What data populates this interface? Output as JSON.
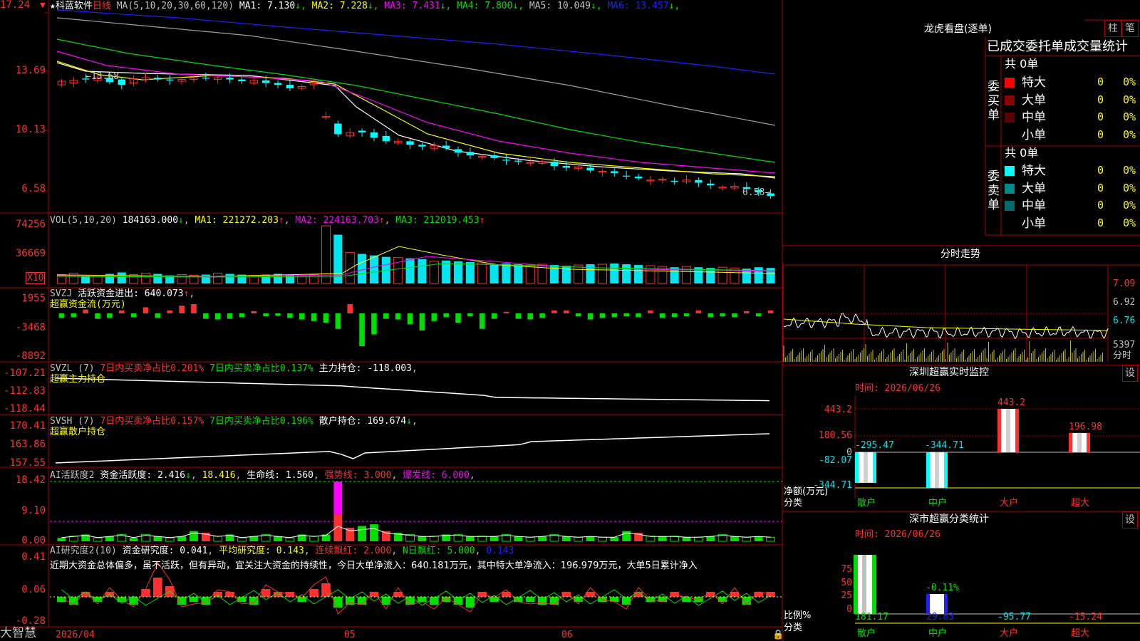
{
  "colors": {
    "up": "#ff3030",
    "down": "#00ffff",
    "vol_down": "#00e5ee",
    "green": "#00e000",
    "yellow": "#ffff00",
    "magenta": "#ff00ff",
    "white": "#ffffff",
    "blue": "#2020ff",
    "grid": "#b00000"
  },
  "main": {
    "stock_name": "科蓝软件",
    "period": "日线",
    "ma_params": "MA(5,10,20,30,60,120)",
    "ma_values": [
      {
        "label": "MA1: 7.130",
        "arrow": "↓",
        "color": "#ffffff"
      },
      {
        "label": "MA2: 7.228",
        "arrow": "↓",
        "color": "#ffff00"
      },
      {
        "label": "MA3: 7.431",
        "arrow": "↓",
        "color": "#ff00ff"
      },
      {
        "label": "MA4: 7.800",
        "arrow": "↓",
        "color": "#00e000"
      },
      {
        "label": "MA5: 10.049",
        "arrow": "↓",
        "color": "#c0c0c0"
      },
      {
        "label": "MA6: 13.457",
        "arrow": "↓",
        "color": "#2020ff"
      }
    ],
    "yticks": [
      "17.24",
      "13.69",
      "10.13",
      "6.58"
    ],
    "high_label": "13.68",
    "low_label": "6.58"
  },
  "vol": {
    "title": "VOL(5,10,20)",
    "value": "184163.000",
    "ma1": "MA1: 221272.203",
    "ma2": "MA2: 224163.703",
    "ma3": "MA3: 212019.453",
    "yticks": [
      "74256",
      "36669"
    ],
    "unit": "X10"
  },
  "svzj": {
    "title": "SVZJ",
    "label": "活跃资金进出: 640.073",
    "subtitle": "超赢资金流(万元)",
    "yticks": [
      "1955",
      "-3468",
      "-8892"
    ]
  },
  "svzl": {
    "title": "SVZL (7)",
    "a": "7日内买卖净占比0.201%",
    "b": "7日内买卖净占比0.137%",
    "c": "主力持仓: -118.003",
    "subtitle": "超赢主力持仓",
    "yticks": [
      "-107.21",
      "-112.83",
      "-118.44"
    ]
  },
  "svsh": {
    "title": "SVSH (7)",
    "a": "7日内买卖净占比0.157%",
    "b": "7日内买卖净占比0.196%",
    "c": "散户持仓: 169.674",
    "subtitle": "超赢散户持仓",
    "yticks": [
      "170.41",
      "163.86",
      "157.55"
    ]
  },
  "ai2": {
    "title": "AI活跃度2",
    "a": "资金活跃度: 2.416",
    "b": "18.416",
    "c": "生命线: 1.560",
    "d": "强势线: 3.000",
    "e": "爆发线: 6.000",
    "yticks": [
      "18.42",
      "9.10",
      "0.00"
    ]
  },
  "ai_research": {
    "title": "AI研究度2(10)",
    "a": "资金研究度: 0.041",
    "b": "平均研究度: 0.143",
    "c": "连续飘红: 2.000",
    "d": "N日飘红: 5.000",
    "e": "0.143",
    "comment": "近期大资金总体偏多，虽不活跃，但有异动，宜关注大资金的持续性，今日大单净流入：640.181万元，其中特大单净流入：196.979万元，大单5日累计净入",
    "yticks": [
      "0.41",
      "0.06",
      "-0.28"
    ]
  },
  "xaxis": {
    "labels": [
      "2026/04",
      "05",
      "06"
    ]
  },
  "logo": "大智慧",
  "right": {
    "lhb_title": "龙虎看盘(逐单)",
    "btn_zhu": "柱",
    "btn_bi": "笔",
    "tabs": "已成交委托单成交量统计",
    "buy": {
      "side": "委买单",
      "total": "共 0单",
      "rows": [
        {
          "name": "特大",
          "val": "0",
          "pct": "0%",
          "color": "#ff0000"
        },
        {
          "name": "大单",
          "val": "0",
          "pct": "0%",
          "color": "#8b0000"
        },
        {
          "name": "中单",
          "val": "0",
          "pct": "0%",
          "color": "#5a0000"
        },
        {
          "name": "小单",
          "val": "0",
          "pct": "0%",
          "color": ""
        }
      ]
    },
    "sell": {
      "side": "委卖单",
      "total": "共 0单",
      "rows": [
        {
          "name": "特大",
          "val": "0",
          "pct": "0%",
          "color": "#00ffff"
        },
        {
          "name": "大单",
          "val": "0",
          "pct": "0%",
          "color": "#008b8b"
        },
        {
          "name": "中单",
          "val": "0",
          "pct": "0%",
          "color": "#006b6b"
        },
        {
          "name": "小单",
          "val": "0",
          "pct": "0%",
          "color": ""
        }
      ]
    },
    "fenshi": {
      "title": "分时走势",
      "yticks": [
        "7.09",
        "6.92",
        "6.76"
      ],
      "vol_label": "5397",
      "unit": "分时"
    },
    "monitor": {
      "title": "深圳超赢实时监控",
      "btn": "设",
      "time": "时间: 2026/06/26",
      "yticks": [
        "443.2",
        "180.56",
        "0",
        "-82.07",
        "-344.71"
      ],
      "ylabel": "净额(万元)",
      "xlabel": "分类",
      "cats": [
        "散户",
        "中户",
        "大户",
        "超大"
      ],
      "values": [
        -295.47,
        -344.71,
        443.2,
        196.98
      ],
      "value_labels": [
        "-295.47",
        "-344.71",
        "443.2",
        "196.98"
      ]
    },
    "classify": {
      "title": "深市超赢分类统计",
      "btn": "设",
      "time": "时间: 2026/06/26",
      "yticks": [
        "75",
        "50",
        "25",
        "0"
      ],
      "ylabel": "比例%",
      "xlabel": "分类",
      "cats": [
        "散户",
        "中户",
        "大户",
        "超大"
      ],
      "bar_label": "-0.11%",
      "bottom_values": [
        "181.17",
        "29.83",
        "-95.77",
        "-15.24"
      ]
    }
  }
}
